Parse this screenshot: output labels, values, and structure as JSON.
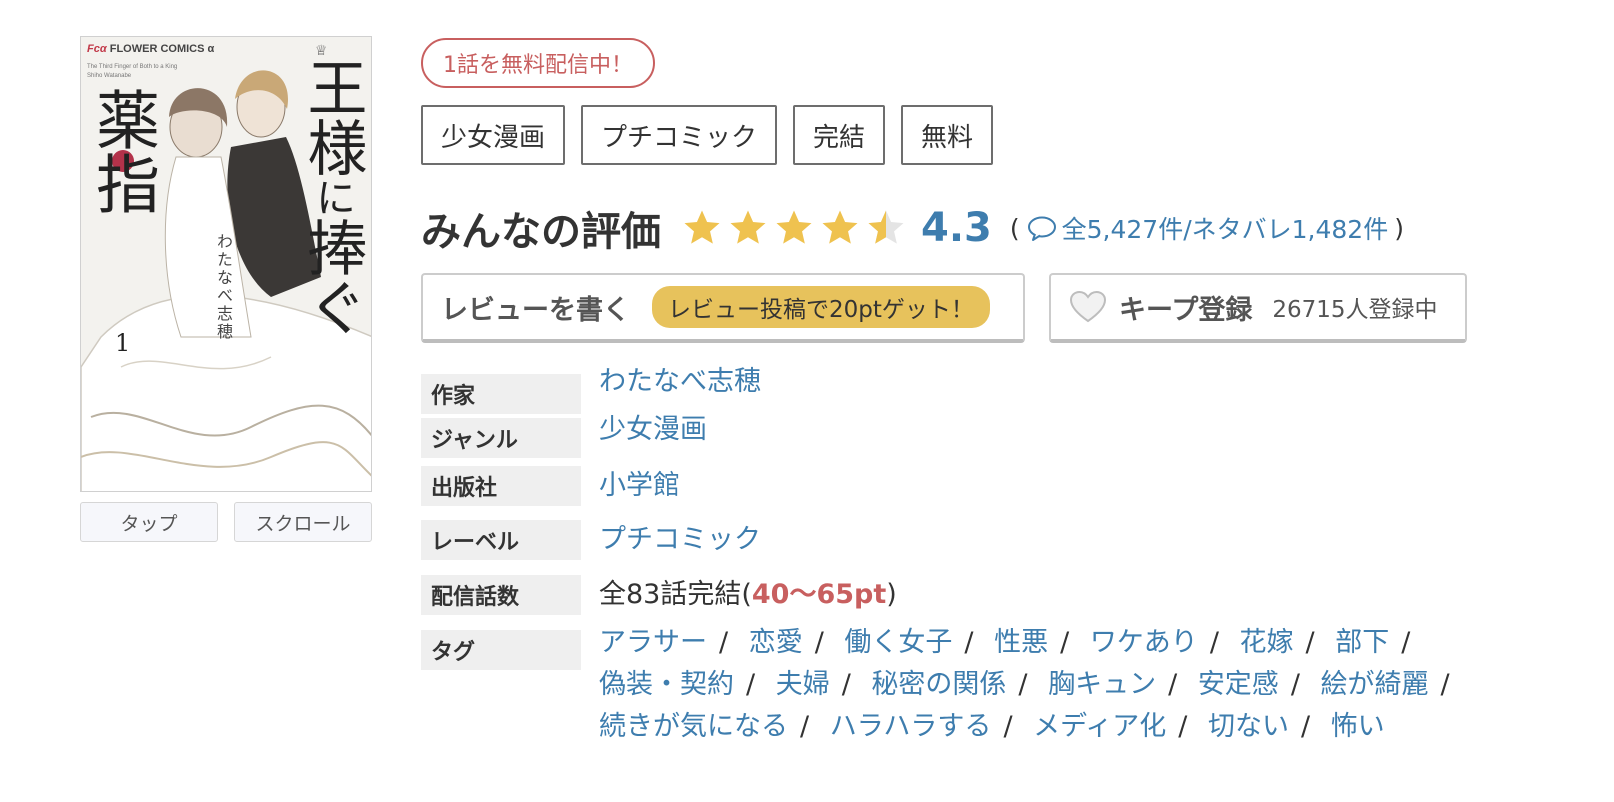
{
  "cover": {
    "publisher_mark": "Fcα",
    "publisher_name": "FLOWER COMICS α",
    "subtitle_en": "The Third Finger of Both to a King",
    "author_en": "Shiho Watanabe",
    "title_part1": "王様",
    "title_part2": "に",
    "title_part3": "捧ぐ",
    "title_part4": "薬指",
    "author": "わたなべ志穂",
    "volume": "1",
    "buttons": [
      "タップ",
      "スクロール"
    ]
  },
  "free_badge": "1話を無料配信中！",
  "genre_tags": [
    "少女漫画",
    "プチコミック",
    "完結",
    "無料"
  ],
  "rating": {
    "label": "みんなの評価",
    "score": "4.3",
    "stars_filled_fraction": 0.86,
    "review_count_text": "全5,427件/ネタバレ1,482件",
    "open_paren": "(",
    "close_paren": ")"
  },
  "actions": {
    "write_review_label": "レビューを書く",
    "write_review_bonus": "レビュー投稿で20ptゲット！",
    "keep_label": "キープ登録",
    "keep_count": "26715人登録中"
  },
  "info": {
    "author_key": "作家",
    "author_val": "わたなべ志穂",
    "genre_key": "ジャンル",
    "genre_val": "少女漫画",
    "publisher_key": "出版社",
    "publisher_val": "小学館",
    "label_key": "レーベル",
    "label_val": "プチコミック",
    "episodes_key": "配信話数",
    "episodes_prefix": "全83話完結(",
    "episodes_price": "40〜65pt",
    "episodes_suffix": ")",
    "tags_key": "タグ",
    "tags": [
      "アラサー",
      "恋愛",
      "働く女子",
      "性悪",
      "ワケあり",
      "花嫁",
      "部下",
      "偽装・契約",
      "夫婦",
      "秘密の関係",
      "胸キュン",
      "安定感",
      "絵が綺麗",
      "続きが気になる",
      "ハラハラする",
      "メディア化",
      "切ない",
      "怖い"
    ],
    "tag_separator": "/"
  },
  "colors": {
    "link": "#3e7dae",
    "accent_red": "#c85f5f",
    "star": "#efc24f",
    "pill": "#e7c25c"
  }
}
